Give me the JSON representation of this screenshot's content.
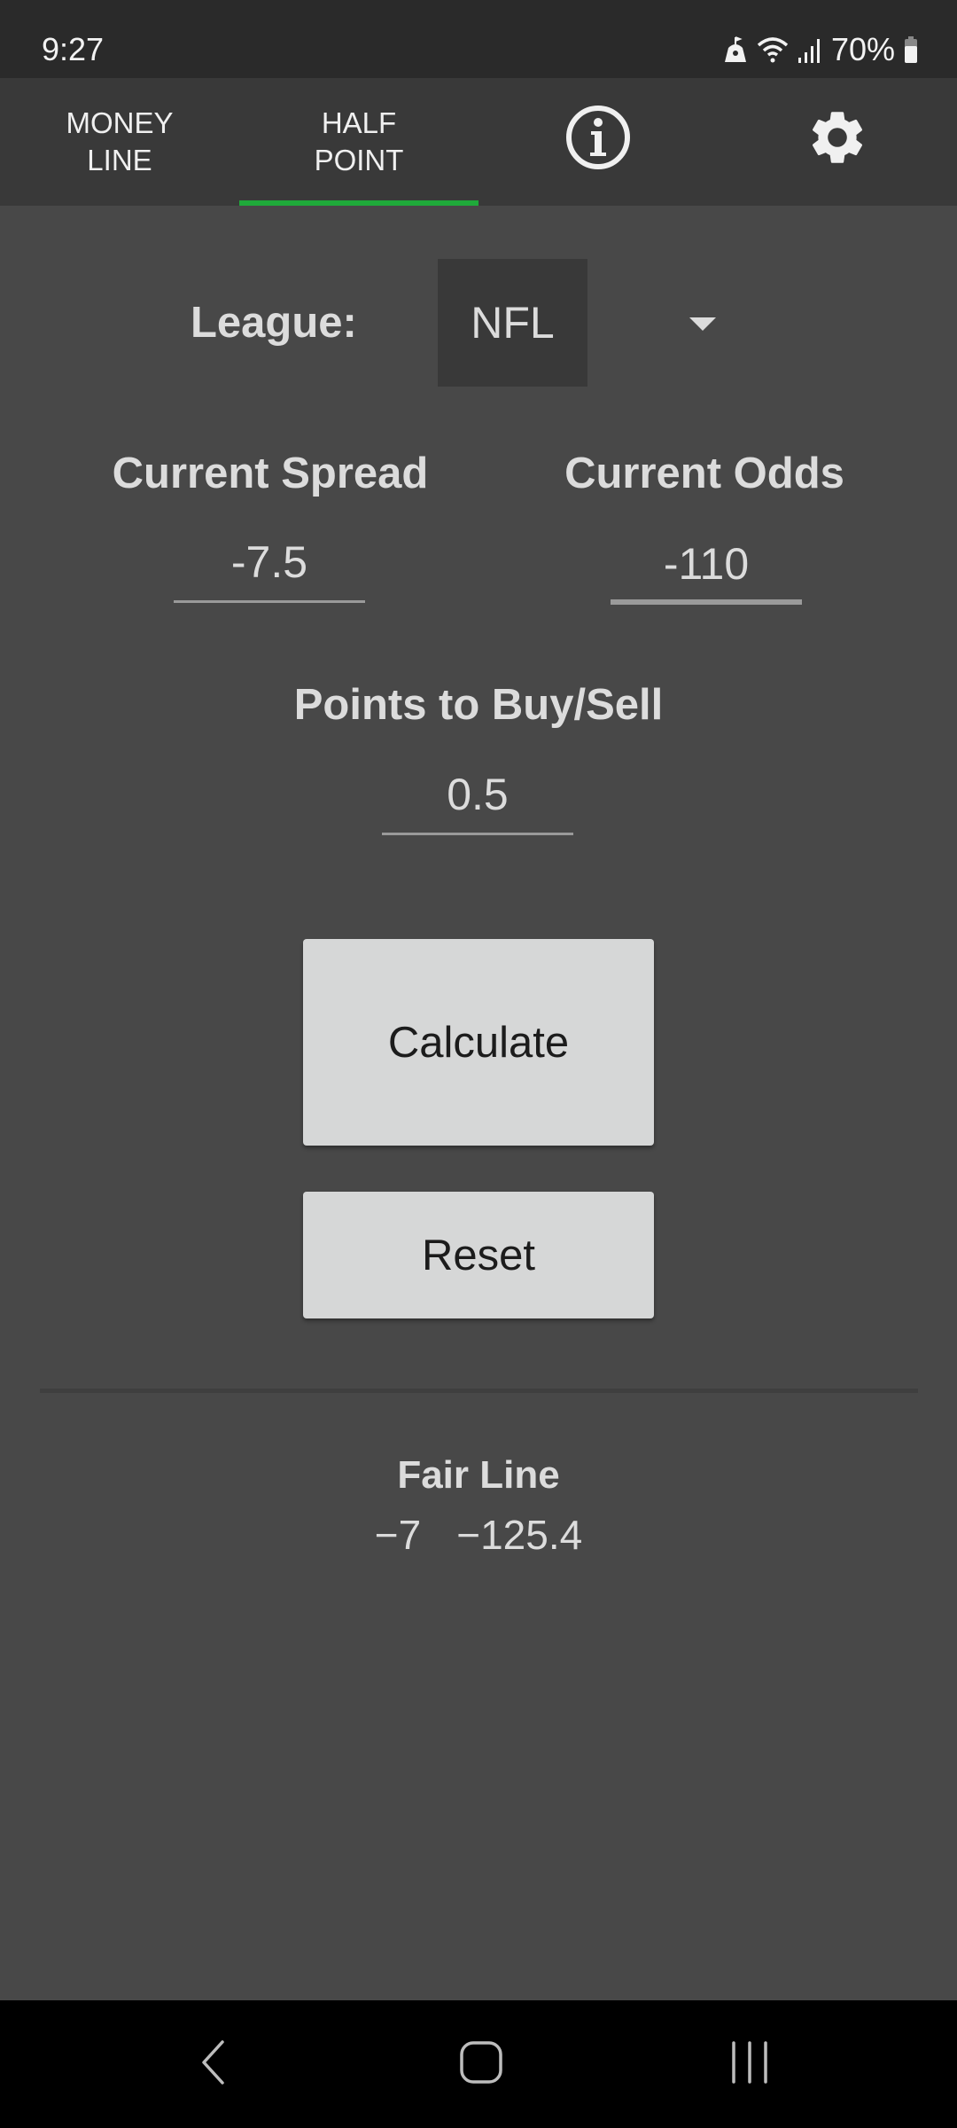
{
  "status_bar": {
    "time": "9:27",
    "battery_percent": "70%",
    "icons": [
      "notification-icon",
      "wifi-icon",
      "signal-icon",
      "battery-icon"
    ]
  },
  "tabs": [
    {
      "label": "MONEY\nLINE",
      "selected": false
    },
    {
      "label": "HALF\nPOINT",
      "selected": true
    },
    {
      "icon": "info-icon",
      "selected": false
    },
    {
      "icon": "gear-icon",
      "selected": false
    }
  ],
  "accent_color": "#1faa3a",
  "form": {
    "league_label": "League:",
    "league_value": "NFL",
    "spread_label": "Current Spread",
    "spread_value": "-7.5",
    "odds_label": "Current Odds",
    "odds_value": "-110",
    "points_label": "Points to Buy/Sell",
    "points_value": "0.5"
  },
  "buttons": {
    "calculate": "Calculate",
    "reset": "Reset"
  },
  "result": {
    "title": "Fair Line",
    "spread": "−7",
    "odds": "−125.4"
  },
  "nav_bar": {
    "icons": [
      "back-icon",
      "home-icon",
      "recent-apps-icon"
    ]
  }
}
